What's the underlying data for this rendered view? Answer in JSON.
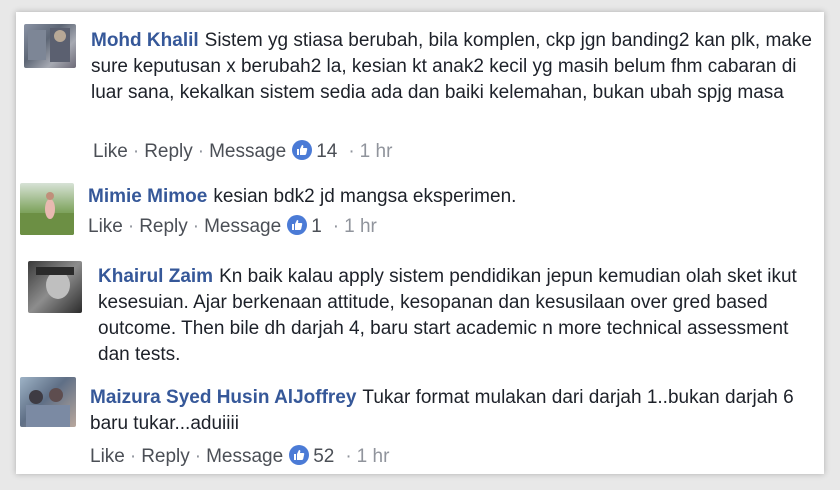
{
  "comments": [
    {
      "name": "Mohd Khalil",
      "text": "Sistem yg stiasa berubah, bila komplen, ckp jgn banding2 kan plk, make sure keputusan x berubah2 la, kesian kt anak2 kecil yg masih belum fhm cabaran di luar sana, kekalkan sistem sedia ada dan baiki kelemahan, bukan ubah spjg masa",
      "like_label": "Like",
      "reply_label": "Reply",
      "message_label": "Message",
      "reactions": "14",
      "time": "1 hr"
    },
    {
      "name": "Mimie Mimoe",
      "text": "kesian bdk2 jd mangsa eksperimen.",
      "like_label": "Like",
      "reply_label": "Reply",
      "message_label": "Message",
      "reactions": "1",
      "time": "1 hr"
    },
    {
      "name": "Khairul Zaim",
      "text": "Kn baik kalau apply sistem pendidikan jepun kemudian olah sket ikut kesesuian. Ajar berkenaan attitude, kesopanan dan kesusilaan over gred based outcome. Then bile dh darjah 4, baru start academic n more technical assessment dan tests."
    },
    {
      "name": "Maizura Syed Husin AlJoffrey",
      "text": "Tukar format mulakan dari darjah 1..bukan darjah 6 baru tukar...aduiiii",
      "like_label": "Like",
      "reply_label": "Reply",
      "message_label": "Message",
      "reactions": "52",
      "time": "1 hr"
    }
  ],
  "colors": {
    "name": "#365899",
    "text": "#1d2129",
    "meta": "#90949c",
    "like_badge": "#4b7bd6"
  },
  "icons": {
    "reaction": "thumbs-up-icon",
    "dot": "middle-dot"
  },
  "separator": "·"
}
